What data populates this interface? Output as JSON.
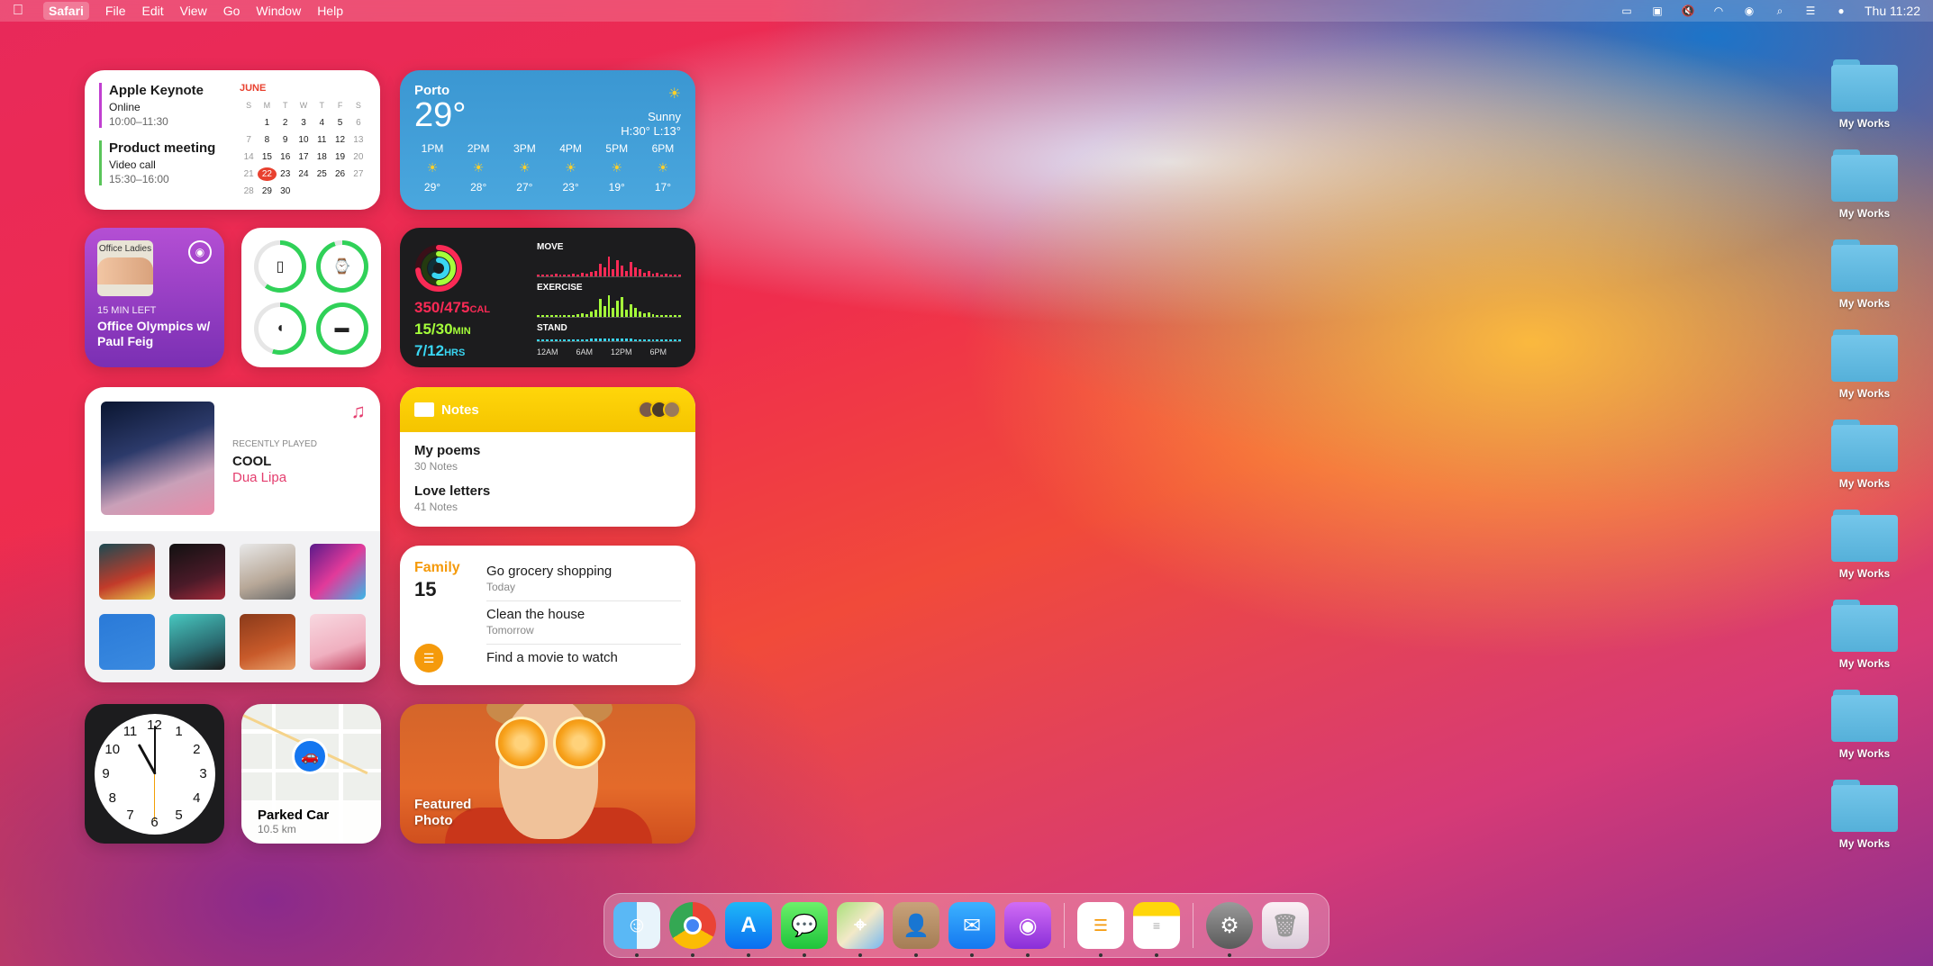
{
  "menubar": {
    "app": "Safari",
    "menus": [
      "File",
      "Edit",
      "View",
      "Go",
      "Window",
      "Help"
    ],
    "clock": "Thu 11:22"
  },
  "calendar": {
    "events": [
      {
        "title": "Apple  Keynote",
        "sub": "Online",
        "time": "10:00–11:30"
      },
      {
        "title": "Product meeting",
        "sub": "Video call",
        "time": "15:30–16:00"
      }
    ],
    "month": "JUNE",
    "weekdays": [
      "S",
      "M",
      "T",
      "W",
      "T",
      "F",
      "S"
    ],
    "weeks": [
      [
        "",
        "",
        "1",
        "2",
        "3",
        "4",
        "5",
        "6"
      ],
      [
        "7",
        "8",
        "9",
        "10",
        "11",
        "12",
        "13"
      ],
      [
        "14",
        "15",
        "16",
        "17",
        "18",
        "19",
        "20"
      ],
      [
        "21",
        "22",
        "23",
        "24",
        "25",
        "26",
        "27"
      ],
      [
        "28",
        "29",
        "30",
        "",
        "",
        "",
        ""
      ]
    ],
    "today": "22"
  },
  "weather": {
    "city": "Porto",
    "temp": "29°",
    "condition": "Sunny",
    "hilo": "H:30° L:13°",
    "hours": [
      {
        "time": "1PM",
        "temp": "29°"
      },
      {
        "time": "2PM",
        "temp": "28°"
      },
      {
        "time": "3PM",
        "temp": "27°"
      },
      {
        "time": "4PM",
        "temp": "23°"
      },
      {
        "time": "5PM",
        "temp": "19°"
      },
      {
        "time": "6PM",
        "temp": "17°"
      }
    ]
  },
  "podcast": {
    "art_text": "Office Ladies",
    "time_left": "15 MIN LEFT",
    "title": "Office Olympics w/ Paul Feig"
  },
  "battery": {
    "devices": [
      {
        "icon": "iphone-icon",
        "level": 0.6
      },
      {
        "icon": "watch-icon",
        "level": 0.95
      },
      {
        "icon": "airpods-icon",
        "level": 0.55
      },
      {
        "icon": "case-icon",
        "level": 1.0
      }
    ],
    "color": "#30d158"
  },
  "activity": {
    "cal": "350/475",
    "cal_unit": "CAL",
    "min": "15/30",
    "min_unit": "MIN",
    "hrs": "7/12",
    "hrs_unit": "HRS",
    "labels": {
      "move": "MOVE",
      "exercise": "EXERCISE",
      "stand": "STAND"
    },
    "axis": [
      "12AM",
      "6AM",
      "12PM",
      "6PM"
    ]
  },
  "music": {
    "label": "RECENTLY PLAYED",
    "song": "COOL",
    "artist": "Dua Lipa"
  },
  "notes": {
    "header": "Notes",
    "items": [
      {
        "title": "My poems",
        "count": "30 Notes"
      },
      {
        "title": "Love letters",
        "count": "41 Notes"
      }
    ]
  },
  "reminders": {
    "list": "Family",
    "count": "15",
    "tasks": [
      {
        "title": "Go grocery shopping",
        "due": "Today"
      },
      {
        "title": "Clean the house",
        "due": "Tomorrow"
      },
      {
        "title": "Find a movie to watch",
        "due": ""
      }
    ]
  },
  "clock": {
    "numbers": [
      "12",
      "1",
      "2",
      "3",
      "4",
      "5",
      "6",
      "7",
      "8",
      "9",
      "10",
      "11"
    ]
  },
  "maps": {
    "title": "Parked Car",
    "distance": "10.5 km"
  },
  "photo": {
    "caption": "Featured Photo"
  },
  "desktop": {
    "folders": [
      "My Works",
      "My Works",
      "My Works",
      "My Works",
      "My Works",
      "My Works",
      "My Works",
      "My Works",
      "My Works"
    ]
  }
}
